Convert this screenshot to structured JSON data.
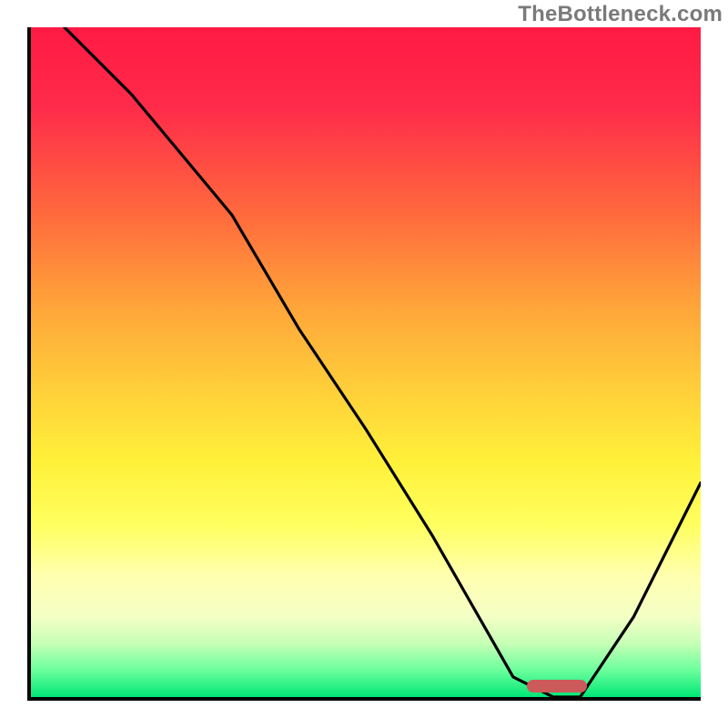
{
  "watermark": "TheBottleneck.com",
  "chart_data": {
    "type": "line",
    "title": "",
    "xlabel": "",
    "ylabel": "",
    "xlim": [
      0,
      100
    ],
    "ylim": [
      0,
      100
    ],
    "grid": false,
    "background": "gradient-red-to-green",
    "gradient_stops": [
      {
        "pos": 0,
        "color": "#ff1a44"
      },
      {
        "pos": 12,
        "color": "#ff2b4a"
      },
      {
        "pos": 28,
        "color": "#ff6a3d"
      },
      {
        "pos": 42,
        "color": "#ffa63a"
      },
      {
        "pos": 55,
        "color": "#ffd23a"
      },
      {
        "pos": 65,
        "color": "#fff13a"
      },
      {
        "pos": 74,
        "color": "#ffff5d"
      },
      {
        "pos": 82,
        "color": "#ffffb0"
      },
      {
        "pos": 88,
        "color": "#f4ffc5"
      },
      {
        "pos": 92,
        "color": "#c6ffb6"
      },
      {
        "pos": 96,
        "color": "#6bff9c"
      },
      {
        "pos": 100,
        "color": "#00e676"
      }
    ],
    "series": [
      {
        "name": "bottleneck-curve",
        "x": [
          5,
          15,
          25,
          30,
          40,
          50,
          60,
          68,
          72,
          78,
          82,
          90,
          100
        ],
        "y": [
          100,
          90,
          78,
          72,
          55,
          40,
          24,
          10,
          3,
          0,
          0,
          12,
          32
        ]
      }
    ],
    "marker": {
      "name": "optimal-range",
      "x_start": 74,
      "x_end": 83,
      "y": 1,
      "color": "#cc5a5a"
    }
  }
}
